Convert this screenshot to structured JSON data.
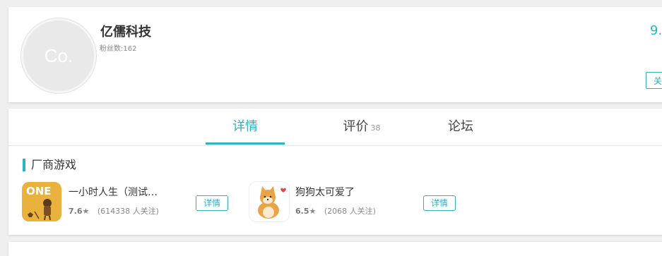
{
  "company": {
    "avatar_text": "Co.",
    "name": "亿儒科技",
    "fans_label": "粉丝数:",
    "fans_count": "162",
    "score": "9.",
    "follow_label": "关"
  },
  "tabs": [
    {
      "label": "详情",
      "active": true
    },
    {
      "label": "评价",
      "count": "38"
    },
    {
      "label": "论坛"
    }
  ],
  "section": {
    "title": "厂商游戏"
  },
  "games": [
    {
      "title": "一小时人生（测试…",
      "rating": "7.6",
      "star": "★",
      "followers": "(614338 人关注)",
      "detail_label": "详情",
      "icon": "one-hour-life-game-icon"
    },
    {
      "title": "狗狗太可爱了",
      "rating": "6.5",
      "star": "★",
      "followers": "(2068 人关注)",
      "detail_label": "详情",
      "icon": "shiba-dog-game-icon"
    }
  ],
  "colors": {
    "accent": "#2bb3c0",
    "background": "#efefef"
  }
}
